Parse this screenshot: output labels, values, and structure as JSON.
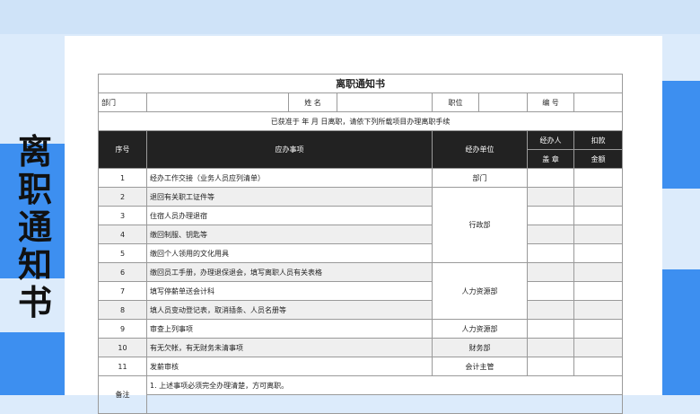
{
  "side_title": [
    "离",
    "职",
    "通",
    "知",
    "书"
  ],
  "form": {
    "title": "离职通知书",
    "info_labels": {
      "department": "部门",
      "name": "姓 名",
      "position": "职位",
      "number": "编 号"
    },
    "notice": "已获准于    年    月    日离职，请依下列所载项目办理离职手续",
    "headers": {
      "index": "序号",
      "task": "应办事项",
      "unit": "经办单位",
      "handler": "经办人",
      "deduction": "扣款",
      "seal": "盖 章",
      "amount": "金额"
    },
    "rows": [
      {
        "no": "1",
        "task": "经办工作交接（业务人员应列清单）",
        "unit": "部门"
      },
      {
        "no": "2",
        "task": "退回有关职工证件等",
        "unit": ""
      },
      {
        "no": "3",
        "task": "住宿人员办理退宿",
        "unit": "行政部"
      },
      {
        "no": "4",
        "task": "缴回制服、钥匙等",
        "unit": ""
      },
      {
        "no": "5",
        "task": "缴回个人领用的文化用具",
        "unit": ""
      },
      {
        "no": "6",
        "task": "缴回员工手册，办理退保退会，填写离职人员有关表格",
        "unit": ""
      },
      {
        "no": "7",
        "task": "填写停薪单送会计科",
        "unit": "人力资源部"
      },
      {
        "no": "8",
        "task": "填人员变动登记表，取消插条、人员名册等",
        "unit": ""
      },
      {
        "no": "9",
        "task": "审查上列事项",
        "unit": "人力资源部"
      },
      {
        "no": "10",
        "task": "有无欠帐，有无财务未清事项",
        "unit": "财务部"
      },
      {
        "no": "11",
        "task": "发薪审核",
        "unit": "会计主管"
      }
    ],
    "remarks_label": "备注",
    "remarks": [
      "1. 上述事项必须完全办理清楚，方可离职。"
    ]
  }
}
